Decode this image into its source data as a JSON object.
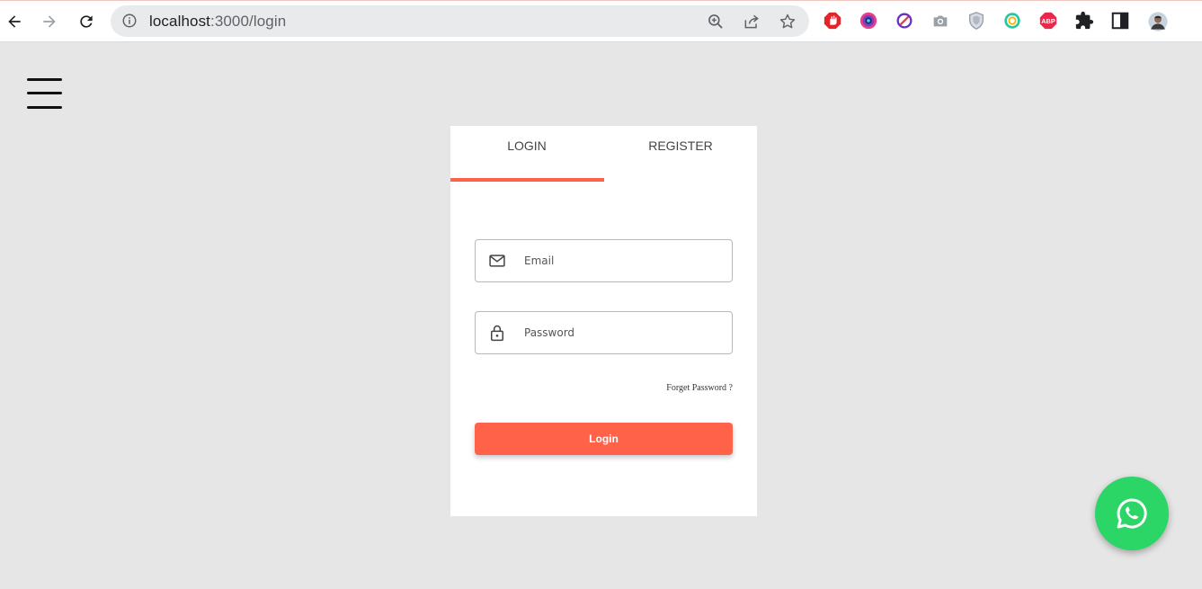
{
  "browser": {
    "url_host": "localhost",
    "url_path": ":3000/login",
    "icons": {
      "back": "arrow-left-icon",
      "forward": "arrow-right-icon",
      "reload": "reload-icon",
      "info": "info-icon",
      "zoom": "zoom-in-icon",
      "share": "share-icon",
      "bookmark": "star-icon"
    },
    "extensions": [
      {
        "name": "stop-hand-extension-icon",
        "color": "#e3242b"
      },
      {
        "name": "color-circle-extension-icon",
        "color": "#7b3fb8"
      },
      {
        "name": "blocked-sign-extension-icon",
        "color": "#6a2ec9"
      },
      {
        "name": "camera-extension-icon",
        "color": "#9aa0a6"
      },
      {
        "name": "shield-extension-icon",
        "color": "#9aa0a6"
      },
      {
        "name": "ring-extension-icon",
        "color": "#26c6a6"
      },
      {
        "name": "adblock-plus-extension-icon",
        "color": "#e8294c",
        "text": "ABP"
      },
      {
        "name": "puzzle-extension-icon",
        "color": "#202124"
      },
      {
        "name": "side-panel-icon",
        "color": "#202124"
      },
      {
        "name": "profile-avatar",
        "color": "#8a6a55"
      }
    ]
  },
  "page": {
    "tabs": {
      "login": "LOGIN",
      "register": "REGISTER"
    },
    "email": {
      "placeholder": "Email"
    },
    "password": {
      "placeholder": "Password"
    },
    "forget_password": "Forget Password ?",
    "login_button": "Login",
    "accent_color": "#ff6248",
    "whatsapp_color": "#2bd566"
  }
}
